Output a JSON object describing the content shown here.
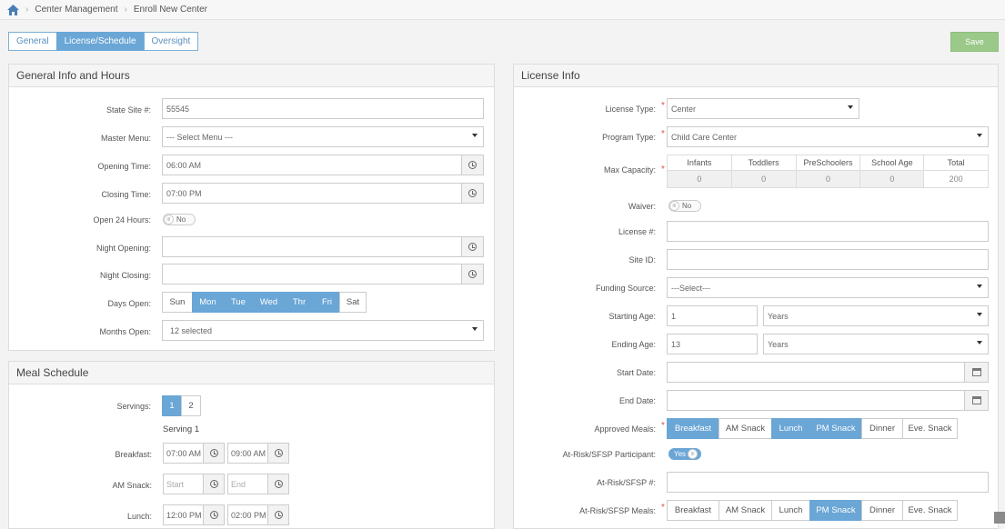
{
  "breadcrumb": {
    "items": [
      "Center Management",
      "Enroll New Center"
    ]
  },
  "tabs": [
    {
      "label": "General"
    },
    {
      "label": "License/Schedule"
    },
    {
      "label": "Oversight"
    }
  ],
  "toolbar": {
    "save_label": "Save"
  },
  "general": {
    "title": "General Info and Hours",
    "state_site_label": "State Site #:",
    "state_site_value": "55545",
    "master_menu_label": "Master Menu:",
    "master_menu_value": "--- Select Menu ---",
    "opening_time_label": "Opening Time:",
    "opening_time_value": "06:00 AM",
    "closing_time_label": "Closing Time:",
    "closing_time_value": "07:00 PM",
    "open24_label": "Open 24 Hours:",
    "open24_value": "No",
    "night_opening_label": "Night Opening:",
    "night_closing_label": "Night Closing:",
    "days_open_label": "Days Open:",
    "days": [
      {
        "label": "Sun",
        "selected": false
      },
      {
        "label": "Mon",
        "selected": true
      },
      {
        "label": "Tue",
        "selected": true
      },
      {
        "label": "Wed",
        "selected": true
      },
      {
        "label": "Thr",
        "selected": true
      },
      {
        "label": "Fri",
        "selected": true
      },
      {
        "label": "Sat",
        "selected": false
      }
    ],
    "months_open_label": "Months Open:",
    "months_open_value": "12 selected"
  },
  "meal": {
    "title": "Meal Schedule",
    "servings_label": "Servings:",
    "servings": [
      {
        "label": "1",
        "selected": true
      },
      {
        "label": "2",
        "selected": false
      }
    ],
    "serving_title": "Serving 1",
    "rows": [
      {
        "label": "Breakfast:",
        "start": "07:00 AM",
        "end": "09:00 AM"
      },
      {
        "label": "AM Snack:",
        "start": "Start",
        "end": "End"
      },
      {
        "label": "Lunch:",
        "start": "12:00 PM",
        "end": "02:00 PM"
      }
    ]
  },
  "license": {
    "title": "License Info",
    "license_type_label": "License Type:",
    "license_type_value": "Center",
    "program_type_label": "Program Type:",
    "program_type_value": "Child Care Center",
    "max_capacity_label": "Max Capacity:",
    "capacity_headers": [
      "Infants",
      "Toddlers",
      "PreSchoolers",
      "School Age",
      "Total"
    ],
    "capacity_values": [
      "0",
      "0",
      "0",
      "0",
      "200"
    ],
    "waiver_label": "Waiver:",
    "waiver_value": "No",
    "license_no_label": "License #:",
    "site_id_label": "Site ID:",
    "funding_label": "Funding Source:",
    "funding_value": "---Select---",
    "starting_age_label": "Starting Age:",
    "starting_age_value": "1",
    "starting_age_unit": "Years",
    "ending_age_label": "Ending Age:",
    "ending_age_value": "13",
    "ending_age_unit": "Years",
    "start_date_label": "Start Date:",
    "end_date_label": "End Date:",
    "approved_meals_label": "Approved Meals:",
    "approved_meals": [
      {
        "label": "Breakfast",
        "selected": true
      },
      {
        "label": "AM Snack",
        "selected": false
      },
      {
        "label": "Lunch",
        "selected": true
      },
      {
        "label": "PM Snack",
        "selected": true
      },
      {
        "label": "Dinner",
        "selected": false
      },
      {
        "label": "Eve. Snack",
        "selected": false
      }
    ],
    "atrisk_participant_label": "At-Risk/SFSP Participant:",
    "atrisk_participant_value": "Yes",
    "atrisk_no_label": "At-Risk/SFSP #:",
    "atrisk_meals_label": "At-Risk/SFSP Meals:",
    "atrisk_meals": [
      {
        "label": "Breakfast",
        "selected": false
      },
      {
        "label": "AM Snack",
        "selected": false
      },
      {
        "label": "Lunch",
        "selected": false
      },
      {
        "label": "PM Snack",
        "selected": true
      },
      {
        "label": "Dinner",
        "selected": false
      },
      {
        "label": "Eve. Snack",
        "selected": false
      }
    ]
  }
}
